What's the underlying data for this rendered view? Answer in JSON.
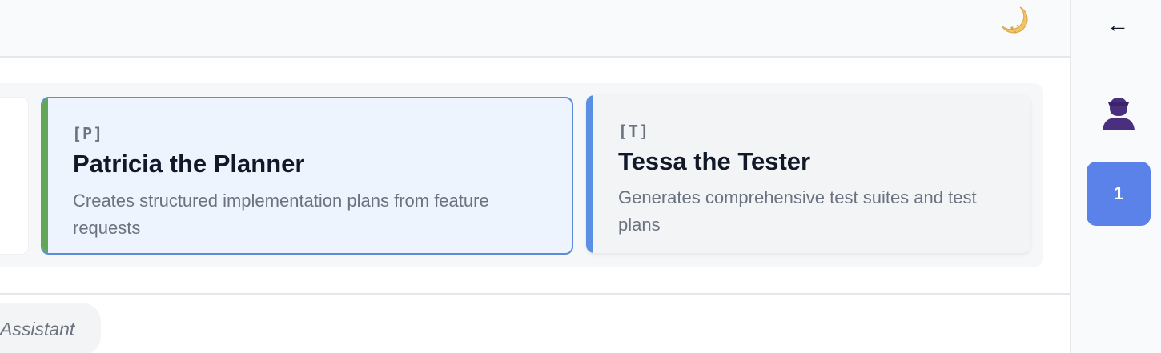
{
  "header": {
    "theme_toggle_icon": "crescent-moon-icon"
  },
  "agents": [
    {
      "initial": "[P]",
      "name": "Patricia the Planner",
      "description": "Creates structured implementation plans from feature requests",
      "accent_color": "#63a658",
      "selected": true
    },
    {
      "initial": "[T]",
      "name": "Tessa the Tester",
      "description": "Generates comprehensive test suites and test plans",
      "accent_color": "#5b8fe4",
      "selected": false
    }
  ],
  "input": {
    "assistant_label": "Assistant"
  },
  "sidebar": {
    "back_icon": "left-arrow-icon",
    "back_glyph": "←",
    "user_icon": "user-silhouette-icon",
    "badge_count": "1",
    "badge_color": "#5b82e8"
  }
}
